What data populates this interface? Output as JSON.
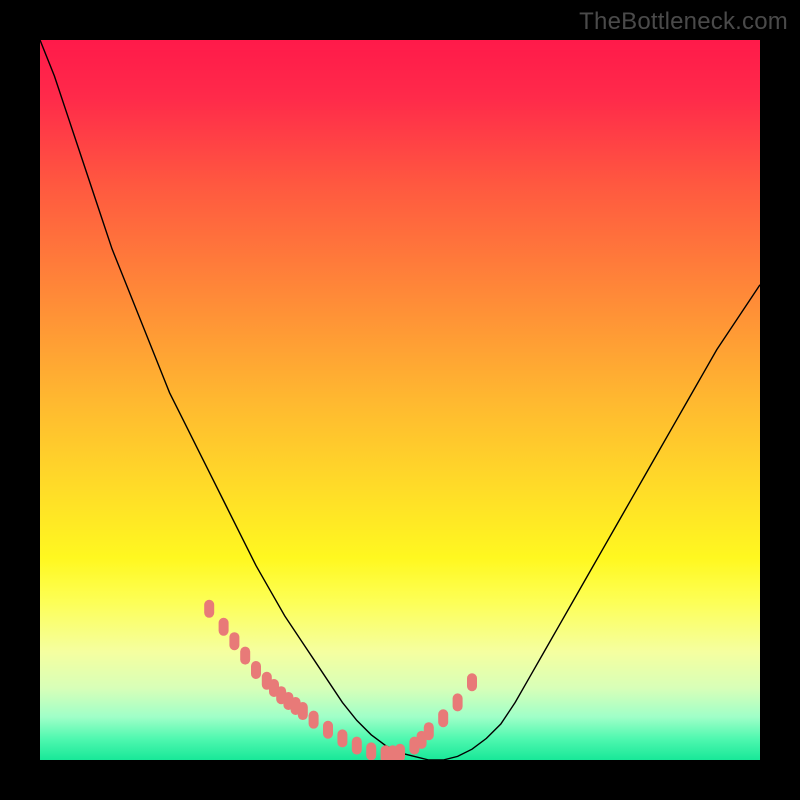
{
  "watermark": "TheBottleneck.com",
  "chart_data": {
    "type": "line",
    "title": "",
    "xlabel": "",
    "ylabel": "",
    "xlim": [
      0,
      100
    ],
    "ylim": [
      0,
      100
    ],
    "series": [
      {
        "name": "curve",
        "x": [
          0,
          2,
          4,
          6,
          8,
          10,
          12,
          14,
          16,
          18,
          20,
          22,
          24,
          26,
          28,
          30,
          32,
          34,
          36,
          38,
          40,
          42,
          44,
          46,
          48,
          50,
          52,
          54,
          56,
          58,
          60,
          62,
          64,
          66,
          68,
          70,
          72,
          74,
          76,
          78,
          80,
          82,
          84,
          86,
          88,
          90,
          92,
          94,
          96,
          98,
          100
        ],
        "y": [
          100,
          95,
          89,
          83,
          77,
          71,
          66,
          61,
          56,
          51,
          47,
          43,
          39,
          35,
          31,
          27,
          23.5,
          20,
          17,
          14,
          11,
          8,
          5.5,
          3.5,
          2,
          1,
          0.5,
          0,
          0,
          0.5,
          1.5,
          3,
          5,
          8,
          11.5,
          15,
          18.5,
          22,
          25.5,
          29,
          32.5,
          36,
          39.5,
          43,
          46.5,
          50,
          53.5,
          57,
          60,
          63,
          66
        ]
      },
      {
        "name": "markers",
        "x": [
          23.5,
          25.5,
          27,
          28.5,
          30,
          31.5,
          32.5,
          33.5,
          34.5,
          35.5,
          36.5,
          38,
          40,
          42,
          44,
          46,
          48,
          49,
          50,
          52,
          53,
          54,
          56,
          58,
          60
        ],
        "y": [
          21,
          18.5,
          16.5,
          14.5,
          12.5,
          11,
          10,
          9,
          8.2,
          7.5,
          6.8,
          5.6,
          4.2,
          3,
          2,
          1.2,
          0.8,
          0.8,
          1,
          2,
          2.8,
          4,
          5.8,
          8,
          10.8
        ]
      }
    ],
    "background_gradient": {
      "top": "#ff1a4a",
      "mid": "#ffdb28",
      "bottom": "#18e898"
    }
  }
}
